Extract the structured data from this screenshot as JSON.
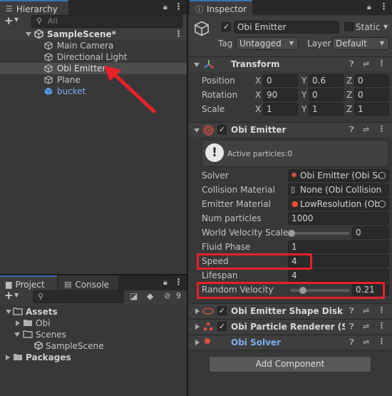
{
  "hierarchy": {
    "tab_label": "Hierarchy",
    "search_placeholder": "All",
    "scene_name": "SampleScene*",
    "items": [
      {
        "label": "Main Camera"
      },
      {
        "label": "Directional Light"
      },
      {
        "label": "Obi Emitter"
      },
      {
        "label": "Plane"
      },
      {
        "label": "bucket"
      }
    ]
  },
  "project": {
    "tab_label": "Project",
    "console_tab_label": "Console",
    "hidden_count": "9",
    "tree": [
      {
        "label": "Assets"
      },
      {
        "label": "Obi"
      },
      {
        "label": "Scenes"
      },
      {
        "label": "SampleScene"
      },
      {
        "label": "Packages"
      }
    ]
  },
  "inspector": {
    "tab_label": "Inspector",
    "object_name": "Obi Emitter",
    "static_label": "Static",
    "tag_label": "Tag",
    "tag_value": "Untagged",
    "layer_label": "Layer",
    "layer_value": "Default",
    "transform": {
      "title": "Transform",
      "rows": [
        {
          "label": "Position",
          "x": "0",
          "y": "0.6",
          "z": "0"
        },
        {
          "label": "Rotation",
          "x": "90",
          "y": "0",
          "z": "0"
        },
        {
          "label": "Scale",
          "x": "1",
          "y": "1",
          "z": "1"
        }
      ],
      "axis_x": "X",
      "axis_y": "Y",
      "axis_z": "Z"
    },
    "emitter": {
      "title": "Obi Emitter",
      "info": "Active particles:0",
      "solver_label": "Solver",
      "solver_value": "Obi Emitter (Obi So",
      "collision_label": "Collision Material",
      "collision_value": "None (Obi Collision",
      "emitter_mat_label": "Emitter Material",
      "emitter_mat_value": "LowResolution (Ob",
      "num_particles_label": "Num particles",
      "num_particles_value": "1000",
      "world_vel_label": "World Velocity Scale",
      "world_vel_value": "0",
      "fluid_phase_label": "Fluid Phase",
      "fluid_phase_value": "1",
      "speed_label": "Speed",
      "speed_value": "4",
      "lifespan_label": "Lifespan",
      "lifespan_value": "4",
      "random_vel_label": "Random Velocity",
      "random_vel_value": "0.21",
      "random_vel_fraction": 0.21
    },
    "components": [
      {
        "title": "Obi Emitter Shape Disk (Scr"
      },
      {
        "title": "Obi Particle Renderer (Scrip"
      },
      {
        "title": "Obi Solver"
      }
    ],
    "add_component_label": "Add Component"
  },
  "colors": {
    "accent": "#3a72b0",
    "highlight_box": "#e8202a",
    "arrow": "#e8202a",
    "link_text": "#7ab0f0"
  }
}
